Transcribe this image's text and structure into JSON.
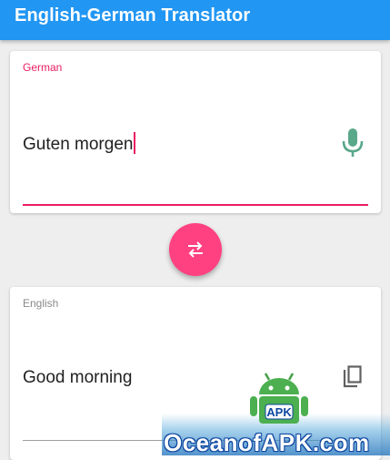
{
  "appbar": {
    "title": "English-German Translator"
  },
  "source": {
    "language_label": "German",
    "text": "Guten morgen",
    "mic_icon": "microphone-icon"
  },
  "swap": {
    "icon": "swap-arrows-icon"
  },
  "target": {
    "language_label": "English",
    "text": "Good morning",
    "copy_icon": "copy-icon"
  },
  "watermark": {
    "text": "OceanofAPK.com",
    "badge": "APK"
  },
  "colors": {
    "primary": "#2196f3",
    "accent": "#ff4081",
    "accent_dark": "#e91e63",
    "mic": "#5aa88a",
    "background": "#eeeeee"
  }
}
